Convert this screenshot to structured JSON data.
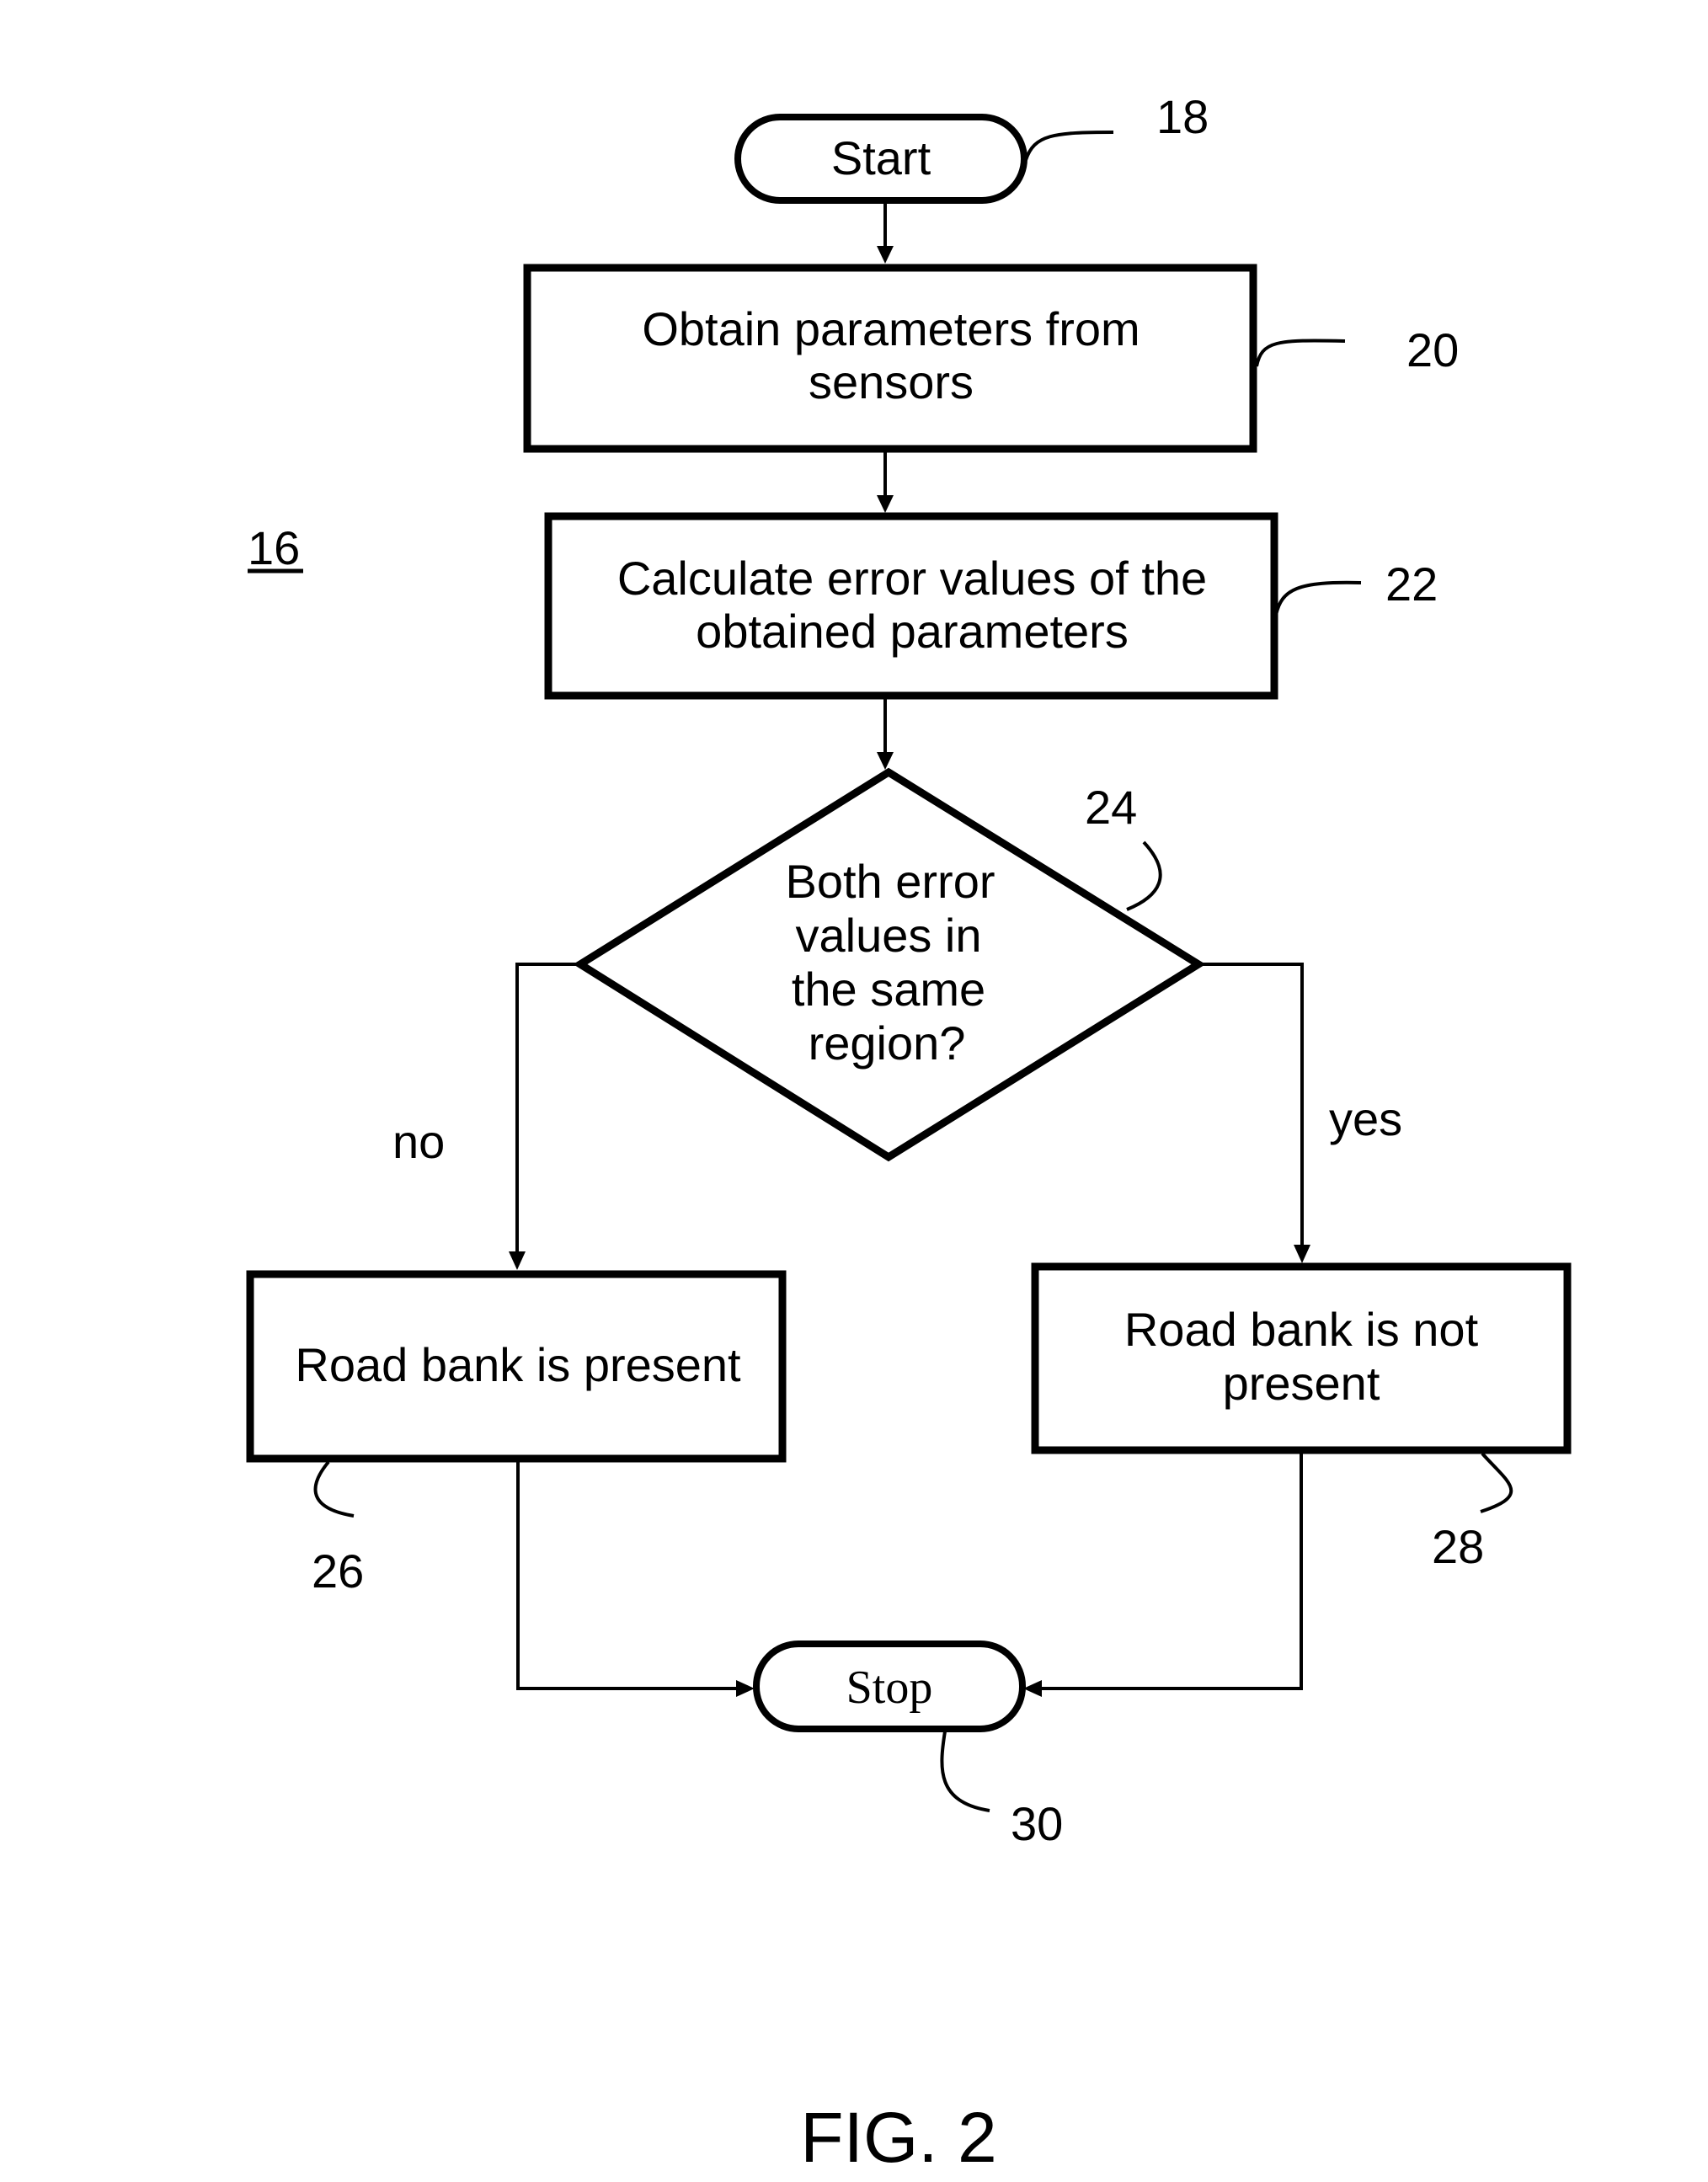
{
  "figure": {
    "caption": "FIG. 2",
    "reference_numeral": "16"
  },
  "nodes": {
    "start": {
      "label": "Start",
      "ref": "18",
      "shape": "terminal"
    },
    "obtain": {
      "lines": [
        "Obtain parameters from",
        "sensors"
      ],
      "ref": "20",
      "shape": "process"
    },
    "calculate": {
      "lines": [
        "Calculate error values of the",
        "obtained parameters"
      ],
      "ref": "22",
      "shape": "process"
    },
    "decision": {
      "lines": [
        "Both error",
        "values in",
        "the same",
        "region?"
      ],
      "ref": "24",
      "shape": "decision"
    },
    "present": {
      "lines": [
        "Road bank is present"
      ],
      "ref": "26",
      "shape": "process"
    },
    "not_present": {
      "lines": [
        "Road bank is not",
        "present"
      ],
      "ref": "28",
      "shape": "process"
    },
    "stop": {
      "label": "Stop",
      "ref": "30",
      "shape": "terminal"
    }
  },
  "edges": {
    "no_label": "no",
    "yes_label": "yes"
  },
  "colors": {
    "stroke": "#000000",
    "background": "#ffffff"
  }
}
